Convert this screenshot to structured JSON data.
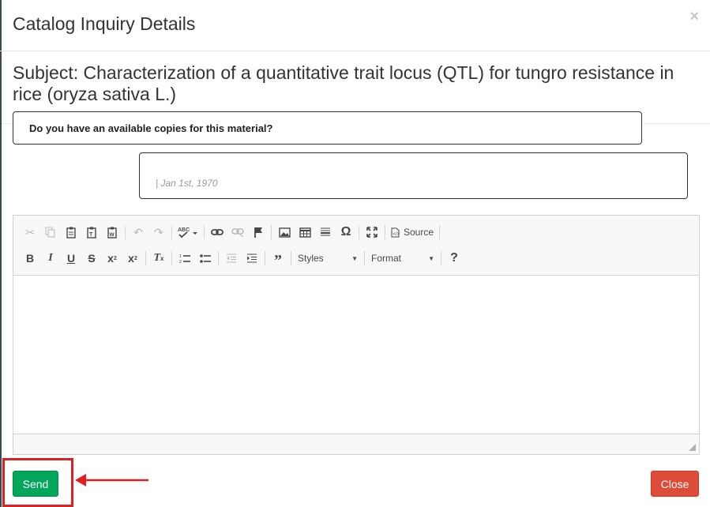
{
  "modal": {
    "title": "Catalog Inquiry Details",
    "close_symbol": "×"
  },
  "subject": {
    "text": "Subject: Characterization of a quantitative trait locus (QTL) for tungro resistance in rice (oryza sativa L.)"
  },
  "question": {
    "text": "Do you have an available copies for this material?"
  },
  "reply": {
    "date": "| Jan 1st, 1970"
  },
  "editor": {
    "source_label": "Source",
    "styles_label": "Styles",
    "format_label": "Format",
    "help_label": "?",
    "omega_label": "Ω",
    "spell_label": "ABC"
  },
  "footer": {
    "send_label": "Send",
    "close_label": "Close"
  },
  "colors": {
    "send": "#00a65a",
    "close": "#dd4b39",
    "highlight": "#e02020"
  }
}
